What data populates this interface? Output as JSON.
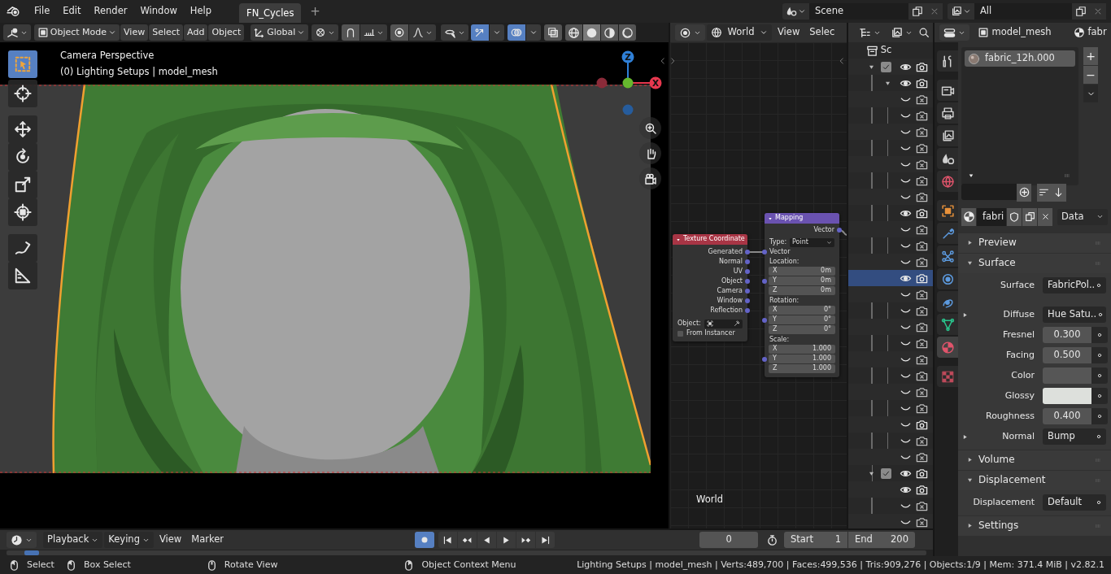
{
  "topbar": {
    "menus": [
      "File",
      "Edit",
      "Render",
      "Window",
      "Help"
    ],
    "workspaces": [
      {
        "label": "FN_Cycles",
        "selected": true
      }
    ],
    "add_tab": "+",
    "scene": "Scene",
    "view_layer": "All"
  },
  "viewport": {
    "mode": "Object Mode",
    "menus": [
      "View",
      "Select",
      "Add",
      "Object"
    ],
    "orientation": "Global",
    "snap_on": false,
    "proportional_on": false,
    "gizmos_on": true,
    "overlays_on": true,
    "xray_on": false,
    "shading": [
      {
        "selected": false
      },
      {
        "selected": true
      },
      {
        "selected": false
      },
      {
        "selected": false
      }
    ],
    "tools": [
      {
        "selected": true
      },
      {
        "selected": false
      },
      {
        "selected": false
      },
      {
        "selected": false
      },
      {
        "selected": false
      },
      {
        "selected": false
      },
      {
        "selected": false
      },
      {
        "selected": false
      }
    ],
    "overlay_title": "Camera Perspective",
    "overlay_info": "(0) Lighting Setups | model_mesh",
    "gizmo_axes": [
      {
        "label": "Z",
        "color": "#2f80d8"
      },
      {
        "label": "X",
        "color": "#e8384f"
      }
    ],
    "picture": {
      "kind": "picture"
    }
  },
  "node_editor": {
    "world": "World",
    "menus": [
      "View",
      "Selec"
    ],
    "area_label": "World",
    "nodes": [
      {
        "kind": "texture_coordinate",
        "title": "Texture Coordinate",
        "color": "#a83545",
        "outputs": [
          "Generated",
          "Normal",
          "UV",
          "Object",
          "Camera",
          "Window",
          "Reflection"
        ],
        "object_label": "Object:",
        "instancer": "From Instancer",
        "instancer_checked": false
      },
      {
        "kind": "mapping",
        "title": "Mapping",
        "color": "#6a52b0",
        "output": "Vector",
        "type_label": "Type:",
        "type_value": "Point",
        "input": "Vector",
        "groups": [
          {
            "label": "Location:",
            "fields": [
              {
                "axis": "X",
                "value": "0m"
              },
              {
                "axis": "Y",
                "value": "0m"
              },
              {
                "axis": "Z",
                "value": "0m"
              }
            ]
          },
          {
            "label": "Rotation:",
            "fields": [
              {
                "axis": "X",
                "value": "0°"
              },
              {
                "axis": "Y",
                "value": "0°"
              },
              {
                "axis": "Z",
                "value": "0°"
              }
            ]
          },
          {
            "label": "Scale:",
            "fields": [
              {
                "axis": "X",
                "value": "1.000"
              },
              {
                "axis": "Y",
                "value": "1.000"
              },
              {
                "axis": "Z",
                "value": "1.000"
              }
            ]
          }
        ]
      }
    ]
  },
  "outliner": {
    "items": [
      {
        "kind": "scene",
        "label": "Sc",
        "selected": false,
        "children": [
          {
            "kind": "collection",
            "checked": true,
            "expanded": true,
            "visible": true,
            "renderable": true,
            "selected": false,
            "children": [
              {
                "expanded": true,
                "visible": true,
                "renderable": true,
                "selected": false,
                "children": [
                  {
                    "visible": false,
                    "renderable": false,
                    "selected": false
                  },
                  {
                    "visible": false,
                    "renderable": false,
                    "selected": false
                  },
                  {
                    "visible": false,
                    "renderable": false,
                    "selected": false
                  },
                  {
                    "visible": false,
                    "renderable": false,
                    "selected": false
                  },
                  {
                    "visible": false,
                    "renderable": false,
                    "selected": false
                  },
                  {
                    "visible": false,
                    "renderable": false,
                    "selected": false
                  },
                  {
                    "visible": false,
                    "renderable": false,
                    "selected": false
                  },
                  {
                    "visible": true,
                    "renderable": true,
                    "selected": false
                  },
                  {
                    "visible": false,
                    "renderable": false,
                    "selected": false
                  },
                  {
                    "visible": false,
                    "renderable": false,
                    "selected": false
                  },
                  {
                    "visible": false,
                    "renderable": false,
                    "selected": false
                  },
                  {
                    "visible": true,
                    "renderable": true,
                    "selected": true
                  },
                  {
                    "visible": false,
                    "renderable": false,
                    "selected": false
                  },
                  {
                    "visible": false,
                    "renderable": false,
                    "selected": false
                  },
                  {
                    "visible": false,
                    "renderable": false,
                    "selected": false
                  },
                  {
                    "visible": false,
                    "renderable": false,
                    "selected": false
                  },
                  {
                    "visible": false,
                    "renderable": false,
                    "selected": false
                  },
                  {
                    "visible": false,
                    "renderable": false,
                    "selected": false
                  },
                  {
                    "visible": false,
                    "renderable": false,
                    "selected": false
                  },
                  {
                    "visible": false,
                    "renderable": false,
                    "selected": false
                  },
                  {
                    "visible": false,
                    "renderable": true,
                    "selected": false
                  },
                  {
                    "visible": false,
                    "renderable": false,
                    "selected": false
                  },
                  {
                    "visible": false,
                    "renderable": false,
                    "selected": false
                  }
                ]
              }
            ]
          },
          {
            "kind": "collection",
            "checked": true,
            "expanded": true,
            "visible": true,
            "renderable": true,
            "selected": false,
            "children": [
              {
                "visible": true,
                "renderable": true,
                "selected": false
              },
              {
                "visible": false,
                "renderable": false,
                "selected": false
              },
              {
                "visible": false,
                "renderable": false,
                "selected": false
              }
            ]
          }
        ]
      }
    ]
  },
  "properties": {
    "object": "model_mesh",
    "material_tab": "fabr",
    "tabs": [
      {
        "selected": false
      },
      {
        "selected": false
      },
      {
        "selected": false
      },
      {
        "selected": false
      },
      {
        "selected": false
      },
      {
        "selected": false
      },
      {
        "selected": false
      },
      {
        "selected": false
      },
      {
        "selected": false
      },
      {
        "selected": false
      },
      {
        "selected": false
      },
      {
        "selected": false
      },
      {
        "selected": true
      },
      {
        "selected": false
      }
    ],
    "slots": [
      {
        "label": "fabric_12h.000",
        "selected": true
      }
    ],
    "slot_buttons": [
      "+",
      "−"
    ],
    "material": {
      "name": "fabri",
      "link": "Data"
    },
    "panels": [
      {
        "title": "Preview",
        "expanded": false
      },
      {
        "title": "Surface",
        "expanded": true,
        "fields": [
          {
            "label": "Surface",
            "kind": "shader",
            "value": "FabricPol.."
          },
          {
            "label": "Diffuse",
            "kind": "link",
            "value": "Hue Satu..",
            "expandable": true
          },
          {
            "label": "Fresnel",
            "kind": "number",
            "value": "0.300"
          },
          {
            "label": "Facing",
            "kind": "number",
            "value": "0.500"
          },
          {
            "label": "Color",
            "kind": "color",
            "color": "#565656"
          },
          {
            "label": "Glossy",
            "kind": "color",
            "color": "#dde0dc"
          },
          {
            "label": "Roughness",
            "kind": "number",
            "value": "0.400"
          },
          {
            "label": "Normal",
            "kind": "link",
            "value": "Bump",
            "expandable": true
          }
        ]
      },
      {
        "title": "Volume",
        "expanded": false
      },
      {
        "title": "Displacement",
        "expanded": true,
        "fields": [
          {
            "label": "Displacement",
            "kind": "link",
            "value": "Default"
          }
        ]
      },
      {
        "title": "Settings",
        "expanded": false
      }
    ]
  },
  "timeline": {
    "menus": [
      {
        "label": "Playback",
        "dropdown": true
      },
      {
        "label": "Keying",
        "dropdown": true
      },
      {
        "label": "View"
      },
      {
        "label": "Marker"
      }
    ],
    "record_on": true,
    "current_frame": "0",
    "start_label": "Start",
    "start": "1",
    "end_label": "End",
    "end": "200"
  },
  "status": {
    "hints": [
      "Select",
      "Box Select",
      "Rotate View",
      "Object Context Menu"
    ],
    "stats": "Lighting Setups | model_mesh | Verts:489,700 | Faces:499,536 | Tris:909,276 | Objects:1/9 | Mem: 371.4 MiB | v2.82.1"
  }
}
